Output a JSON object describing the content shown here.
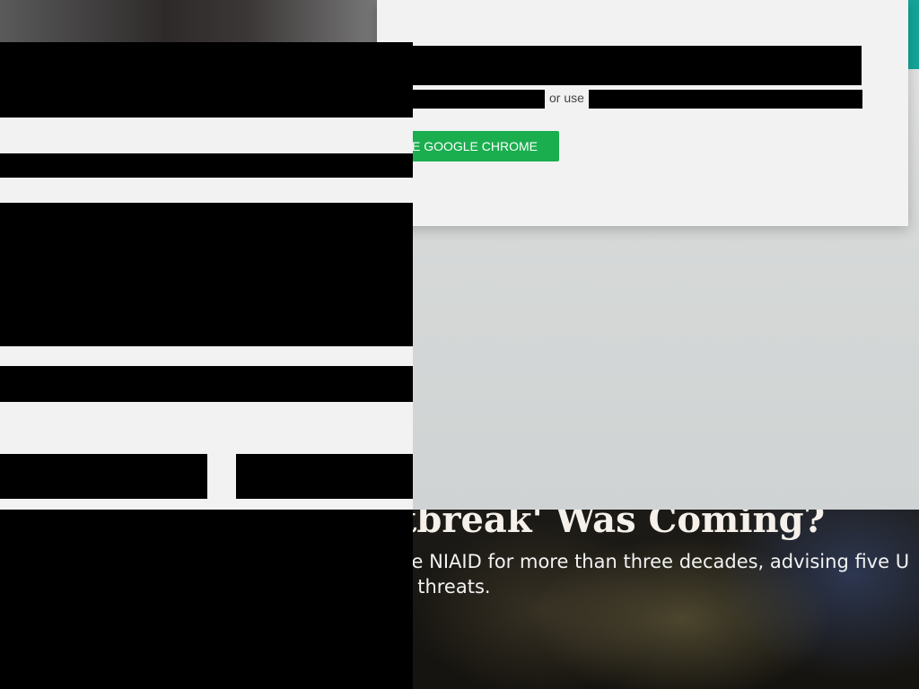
{
  "hero": {
    "title": "Outbreak' Was Coming?",
    "subtitle_line1": "the NIAID for more than three decades, advising five U",
    "subtitle_line2": "th threats."
  },
  "popup": {
    "or_use": "or use",
    "chrome_button": "E GOOGLE CHROME"
  },
  "colors": {
    "chrome_button": "#1aae4f",
    "accent_tab": "#15a59a",
    "panel_bg": "#f2f2f2"
  }
}
